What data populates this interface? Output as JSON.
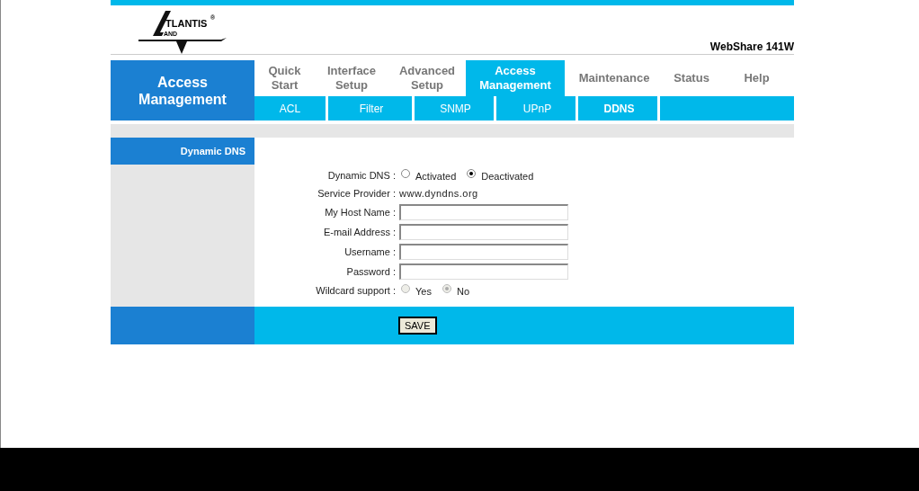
{
  "logo": {
    "text": "TLANTIS",
    "mark": "®",
    "sub": "AND"
  },
  "model": "WebShare 141W",
  "section_title": "Access Management",
  "tabs": [
    {
      "label": "Quick Start",
      "selected": false
    },
    {
      "label": "Interface Setup",
      "selected": false
    },
    {
      "label": "Advanced Setup",
      "selected": false
    },
    {
      "label": "Access Management",
      "selected": true
    },
    {
      "label": "Maintenance",
      "selected": false
    },
    {
      "label": "Status",
      "selected": false
    },
    {
      "label": "Help",
      "selected": false
    }
  ],
  "subtabs": [
    {
      "label": "ACL",
      "selected": false
    },
    {
      "label": "Filter",
      "selected": false
    },
    {
      "label": "SNMP",
      "selected": false
    },
    {
      "label": "UPnP",
      "selected": false
    },
    {
      "label": "DDNS",
      "selected": true
    }
  ],
  "panel_title": "Dynamic DNS",
  "form": [
    {
      "kind": "radio",
      "label": "Dynamic DNS :",
      "options": [
        {
          "label": "Activated",
          "selected": false
        },
        {
          "label": "Deactivated",
          "selected": true
        }
      ],
      "disabled": false
    },
    {
      "kind": "text",
      "label": "Service Provider :",
      "value": "www.dyndns.org"
    },
    {
      "kind": "input",
      "label": "My Host Name :"
    },
    {
      "kind": "input",
      "label": "E-mail Address :"
    },
    {
      "kind": "input",
      "label": "Username :"
    },
    {
      "kind": "input",
      "label": "Password :"
    },
    {
      "kind": "radio",
      "label": "Wildcard support :",
      "options": [
        {
          "label": "Yes",
          "selected": false
        },
        {
          "label": "No",
          "selected": true
        }
      ],
      "disabled": true
    }
  ],
  "save_button": "SAVE"
}
